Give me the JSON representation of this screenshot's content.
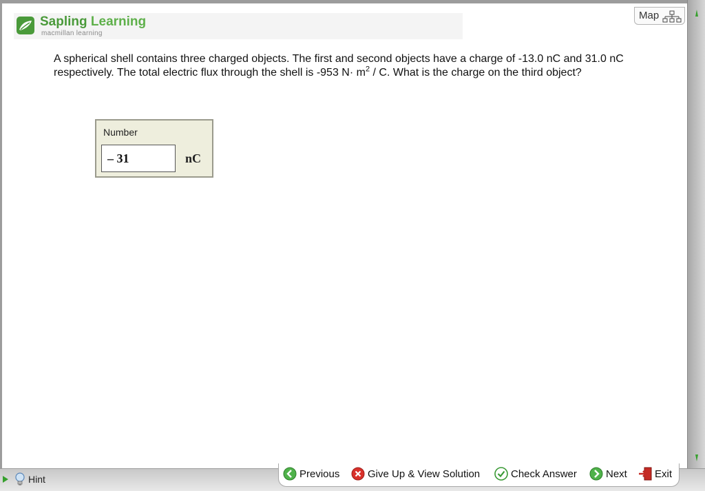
{
  "brand": {
    "name_first": "Sapling",
    "name_second": "Learning",
    "tagline": "macmillan learning",
    "icon": "sapling-leaf-icon",
    "color": "#4a9a3a"
  },
  "map_button": {
    "label": "Map",
    "icon": "map-tree-icon"
  },
  "question": {
    "text_before": "A spherical shell contains three charged objects. The first and second objects have a charge of -13.0 nC and 31.0 nC respectively. The total electric flux through the shell is -953 N· m",
    "superscript": "2",
    "text_after": " / C. What is the charge on the third object?"
  },
  "answer": {
    "label": "Number",
    "value": "– 31",
    "unit": "nC"
  },
  "hint": {
    "label": "Hint",
    "icon": "lightbulb-icon"
  },
  "nav": {
    "previous": {
      "label": "Previous",
      "icon": "arrow-left-circle-icon"
    },
    "give_up": {
      "label": "Give Up & View Solution",
      "icon": "x-circle-icon"
    },
    "check": {
      "label": "Check Answer",
      "icon": "checkmark-circle-icon"
    },
    "next": {
      "label": "Next",
      "icon": "arrow-right-circle-icon"
    },
    "exit": {
      "label": "Exit",
      "icon": "exit-door-icon"
    }
  },
  "colors": {
    "accent_green": "#36a02d",
    "answer_box_bg": "#eeeedd",
    "give_up_red": "#d9312b"
  }
}
